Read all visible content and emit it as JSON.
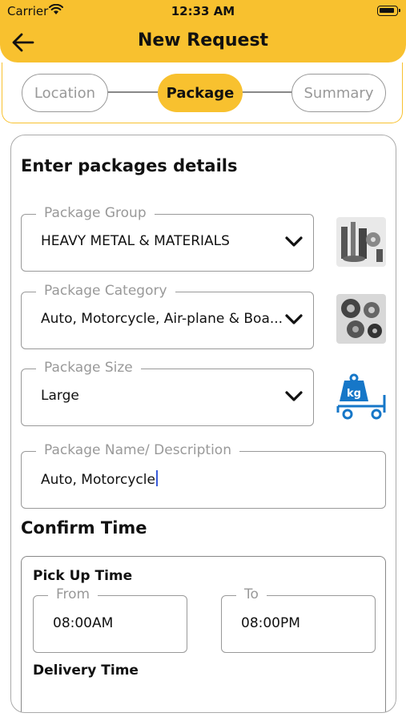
{
  "status_bar": {
    "carrier": "Carrier",
    "time": "12:33 AM"
  },
  "header": {
    "title": "New Request"
  },
  "stepper": {
    "steps": [
      {
        "label": "Location",
        "active": false
      },
      {
        "label": "Package",
        "active": true
      },
      {
        "label": "Summary",
        "active": false
      }
    ]
  },
  "form": {
    "title": "Enter packages details",
    "package_group": {
      "label": "Package Group",
      "value": "HEAVY METAL & MATERIALS"
    },
    "package_category": {
      "label": "Package Category",
      "value": "Auto, Motorcycle, Air-plane & Boa..."
    },
    "package_size": {
      "label": "Package Size",
      "value": "Large"
    },
    "package_name": {
      "label": "Package Name/ Description",
      "value": "Auto, Motorcycle"
    },
    "size_icon_text": "kg"
  },
  "confirm_time": {
    "title": "Confirm Time",
    "pickup": {
      "title": "Pick Up Time",
      "from_label": "From",
      "from_value": "08:00AM",
      "to_label": "To",
      "to_value": "08:00PM"
    },
    "delivery": {
      "title": "Delivery Time"
    }
  },
  "colors": {
    "accent": "#F8C12F",
    "icon_blue": "#1677C8"
  }
}
